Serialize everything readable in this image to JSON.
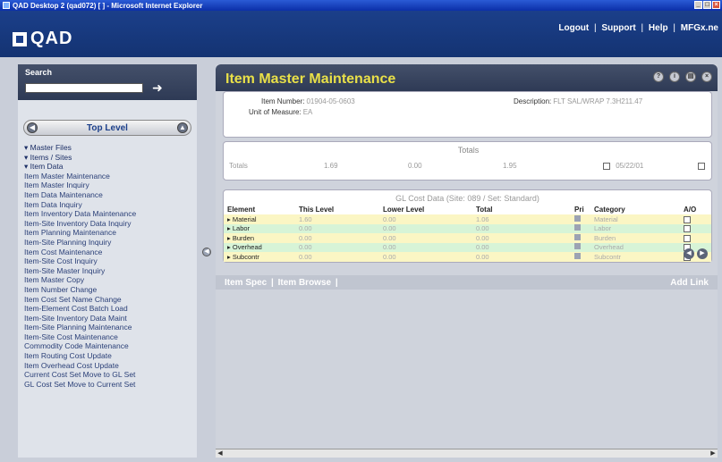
{
  "window": {
    "title": "QAD Desktop 2 (qad072) [ ] - Microsoft Internet Explorer"
  },
  "header": {
    "logo": "QAD",
    "links": [
      "Logout",
      "Support",
      "Help",
      "MFGx.ne"
    ]
  },
  "search": {
    "label": "Search",
    "placeholder": ""
  },
  "nav": {
    "top_level_label": "Top Level",
    "items": [
      {
        "label": "Master Files",
        "folder": true
      },
      {
        "label": "Items / Sites",
        "folder": true
      },
      {
        "label": "Item Data",
        "folder": true
      },
      {
        "label": "Item Master Maintenance"
      },
      {
        "label": "Item Master Inquiry"
      },
      {
        "label": "Item Data Maintenance"
      },
      {
        "label": "Item Data Inquiry"
      },
      {
        "label": "Item Inventory Data Maintenance"
      },
      {
        "label": "Item-Site Inventory Data Inquiry"
      },
      {
        "label": "Item Planning Maintenance"
      },
      {
        "label": "Item-Site Planning Inquiry"
      },
      {
        "label": "Item Cost Maintenance"
      },
      {
        "label": "Item-Site Cost Inquiry"
      },
      {
        "label": "Item-Site Master Inquiry"
      },
      {
        "label": "Item Master Copy"
      },
      {
        "label": "Item Number Change"
      },
      {
        "label": "Item Cost Set Name Change"
      },
      {
        "label": "Item-Element Cost Batch Load"
      },
      {
        "label": "Item-Site Inventory Data Maint"
      },
      {
        "label": "Item-Site Planning Maintenance"
      },
      {
        "label": "Item-Site Cost Maintenance"
      },
      {
        "label": "Commodity Code Maintenance"
      },
      {
        "label": "Item Routing Cost Update"
      },
      {
        "label": "Item Overhead Cost Update"
      },
      {
        "label": "Current Cost Set Move to GL Set"
      },
      {
        "label": "GL Cost Set Move to Current Set"
      }
    ]
  },
  "main": {
    "title": "Item Master Maintenance",
    "item_number_label": "Item Number:",
    "item_number": "01904-05-0603",
    "uom_label": "Unit of Measure:",
    "uom": "EA",
    "description_label": "Description:",
    "description": "FLT SAL/WRAP 7.3H211.47",
    "totals": {
      "title": "Totals",
      "label": "Totals",
      "values": [
        "1.69",
        "0.00",
        "1.95"
      ],
      "date": "05/22/01"
    },
    "gl": {
      "title": "GL Cost Data (Site: 089 / Set: Standard)",
      "headers": [
        "Element",
        "This Level",
        "Lower Level",
        "Total",
        "Pri",
        "Category",
        "A/O"
      ],
      "rows": [
        {
          "element": "Material",
          "this_level": "1.60",
          "lower": "0.00",
          "total": "1.06",
          "category": "Material"
        },
        {
          "element": "Labor",
          "this_level": "0.00",
          "lower": "0.00",
          "total": "0.00",
          "category": "Labor"
        },
        {
          "element": "Burden",
          "this_level": "0.00",
          "lower": "0.00",
          "total": "0.00",
          "category": "Burden"
        },
        {
          "element": "Overhead",
          "this_level": "0.00",
          "lower": "0.00",
          "total": "0.00",
          "category": "Overhead"
        },
        {
          "element": "Subcontr",
          "this_level": "0.00",
          "lower": "0.00",
          "total": "0.00",
          "category": "Subcontr"
        }
      ]
    },
    "links": {
      "item_spec": "Item Spec",
      "item_browse": "Item Browse",
      "add_link": "Add Link"
    }
  }
}
